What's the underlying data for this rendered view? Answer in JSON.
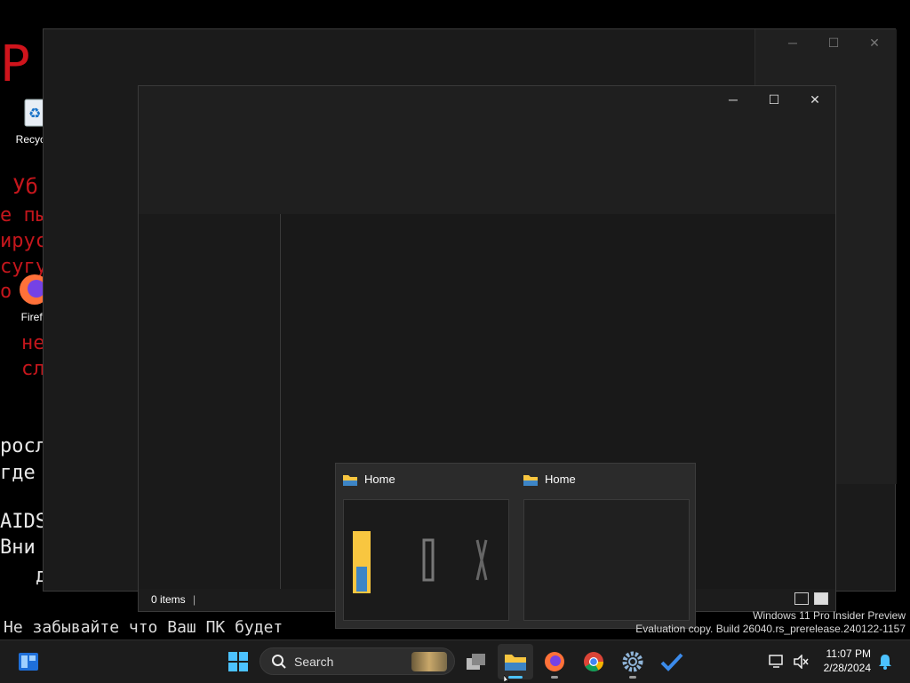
{
  "wallpaper": {
    "big_fragment": "Р",
    "red_lines": [
      "Уб",
      "е пы",
      "ирус",
      "сугу",
      "о",
      "не",
      "сл"
    ],
    "white_lines": [
      "росл",
      "где",
      "AIDS",
      "Вни",
      "д"
    ],
    "bottom_line": "Не забывайте что Ваш ПК будет"
  },
  "desktop_icons": [
    {
      "label": "Recycle",
      "icon": "recycle-bin-icon"
    },
    {
      "label": "Firefo",
      "icon": "firefox-icon"
    }
  ],
  "explorer": {
    "status_items": "0 items"
  },
  "preview": {
    "thumbs": [
      {
        "title": "Home",
        "icon": "folder-icon"
      },
      {
        "title": "Home",
        "icon": "folder-icon"
      }
    ]
  },
  "watermark": {
    "line1": "Windows 11 Pro Insider Preview",
    "line2": "Evaluation copy. Build 26040.rs_prerelease.240122-1157"
  },
  "taskbar": {
    "search_label": "Search",
    "time": "11:07 PM",
    "date": "2/28/2024"
  },
  "colors": {
    "accent": "#4cc2ff",
    "wallpaper_red": "#c4161c"
  }
}
